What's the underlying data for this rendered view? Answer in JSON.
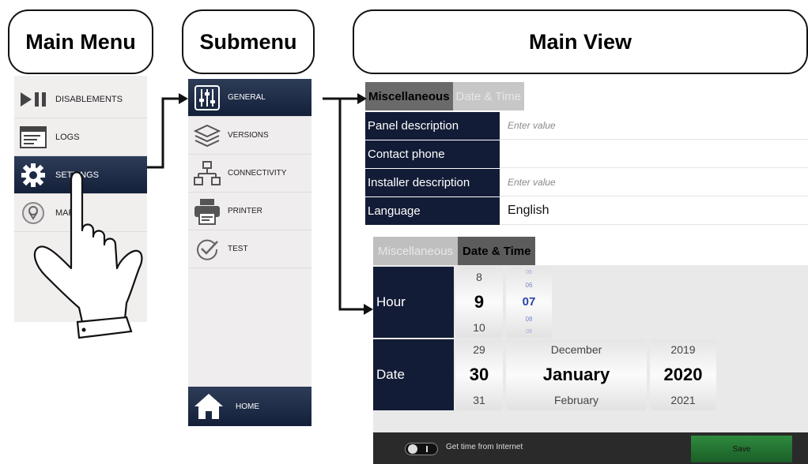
{
  "headers": {
    "main_menu": "Main Menu",
    "submenu": "Submenu",
    "main_view": "Main View"
  },
  "main_menu": {
    "items": [
      {
        "label": "DISABLEMENTS",
        "icon": "play-pause-icon",
        "active": false
      },
      {
        "label": "LOGS",
        "icon": "window-log-icon",
        "active": false
      },
      {
        "label": "SETTINGS",
        "icon": "gear-icon",
        "active": true
      },
      {
        "label": "MAP",
        "icon": "map-pin-icon",
        "active": false
      }
    ]
  },
  "submenu": {
    "items": [
      {
        "label": "GENERAL",
        "icon": "sliders-icon",
        "active": true
      },
      {
        "label": "VERSIONS",
        "icon": "layers-icon",
        "active": false
      },
      {
        "label": "CONNECTIVITY",
        "icon": "network-icon",
        "active": false
      },
      {
        "label": "PRINTER",
        "icon": "printer-icon",
        "active": false
      },
      {
        "label": "TEST",
        "icon": "check-circle-icon",
        "active": false
      }
    ],
    "home": {
      "label": "HOME",
      "icon": "home-icon"
    }
  },
  "main_view_misc": {
    "tabs": [
      {
        "label": "Miscellaneous",
        "active": true
      },
      {
        "label": "Date & Time",
        "active": false
      }
    ],
    "rows": [
      {
        "label": "Panel description",
        "value": "",
        "placeholder": "Enter value"
      },
      {
        "label": "Contact phone",
        "value": "",
        "placeholder": ""
      },
      {
        "label": "Installer description",
        "value": "",
        "placeholder": "Enter value"
      },
      {
        "label": "Language",
        "value": "English",
        "placeholder": ""
      }
    ]
  },
  "main_view_datetime": {
    "tabs": [
      {
        "label": "Miscellaneous",
        "active": false
      },
      {
        "label": "Date & Time",
        "active": true
      }
    ],
    "hour_label": "Hour",
    "date_label": "Date",
    "hour": {
      "prev": "8",
      "current": "9",
      "next": "10"
    },
    "minute": {
      "prev2": "05",
      "prev": "06",
      "current": "07",
      "next": "08",
      "next2": "09"
    },
    "day": {
      "prev": "29",
      "current": "30",
      "next": "31"
    },
    "month": {
      "prev": "December",
      "current": "January",
      "next": "February"
    },
    "year": {
      "prev": "2019",
      "current": "2020",
      "next": "2021"
    },
    "footer": {
      "toggle_label": "Get time from Internet",
      "toggle_on": false,
      "save_label": "Save"
    }
  },
  "colors": {
    "navy_active": "#14203a",
    "save_green": "#2f8a3e",
    "minute_blue": "#2a43a8"
  }
}
